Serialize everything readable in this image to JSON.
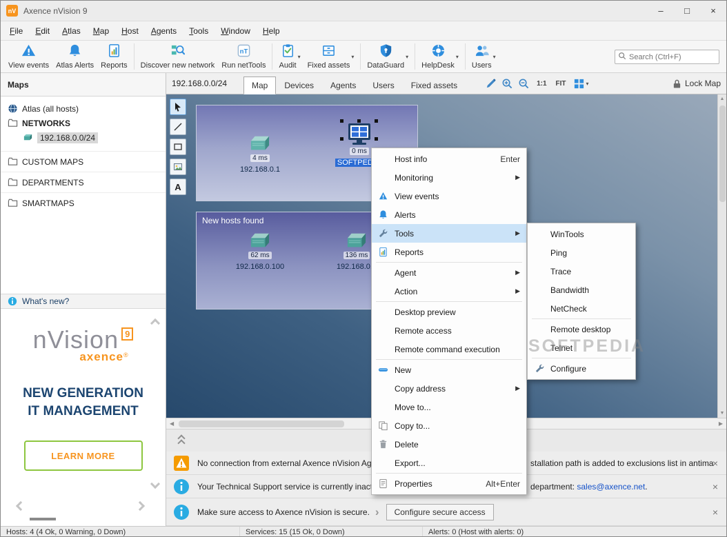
{
  "colors": {
    "accent_blue": "#2f8ede",
    "brand_orange": "#f7941e",
    "brand_green": "#8dc63f",
    "warning_orange": "#f59b00",
    "info_blue": "#29abe2",
    "menu_highlight": "#cbe3f8",
    "host_selection_blue": "#2a6bd4",
    "map_dark": "#27496c",
    "map_light": "#9aa9ba"
  },
  "window": {
    "icon_text": "nV",
    "title": "Axence nVision 9",
    "controls": {
      "minimize": "–",
      "maximize": "□",
      "close": "×"
    }
  },
  "menubar": {
    "items": [
      {
        "label": "File"
      },
      {
        "label": "Edit"
      },
      {
        "label": "Atlas"
      },
      {
        "label": "Map"
      },
      {
        "label": "Host"
      },
      {
        "label": "Agents"
      },
      {
        "label": "Tools"
      },
      {
        "label": "Window"
      },
      {
        "label": "Help"
      }
    ]
  },
  "toolbar": {
    "view_events": "View events",
    "atlas_alerts": "Atlas Alerts",
    "reports": "Reports",
    "discover": "Discover new network",
    "nettools": "Run netTools",
    "nettools_badge": "nT",
    "audit": "Audit",
    "fixed_assets": "Fixed assets",
    "dataguard": "DataGuard",
    "helpdesk": "HelpDesk",
    "users": "Users",
    "search_placeholder": "Search (Ctrl+F)"
  },
  "sidebar": {
    "header": "Maps",
    "tree": {
      "atlas": "Atlas (all hosts)",
      "networks": "NETWORKS",
      "network_child": "192.168.0.0/24",
      "custom_maps": "CUSTOM MAPS",
      "departments": "DEPARTMENTS",
      "smartmaps": "SMARTMAPS"
    },
    "whats_new": "What's new?",
    "ad": {
      "logo_text": "nVision",
      "logo_badge": "9",
      "brand": "axence",
      "reg": "®",
      "headline1": "NEW GENERATION",
      "headline2": "IT MANAGEMENT",
      "cta": "LEARN MORE"
    }
  },
  "map_panel": {
    "network_label": "192.168.0.0/24",
    "tabs": [
      {
        "label": "Map"
      },
      {
        "label": "Devices"
      },
      {
        "label": "Agents"
      },
      {
        "label": "Users"
      },
      {
        "label": "Fixed assets"
      }
    ],
    "zoom_actual": "1:1",
    "zoom_fit": "FIT",
    "lock_label": "Lock Map",
    "text_tool_glyph": "A",
    "boxes": [
      {
        "title": "",
        "hosts": [
          {
            "ping": "4 ms",
            "name": "192.168.0.1"
          },
          {
            "ping": "0 ms",
            "name": "SOFTPEDI..."
          }
        ]
      },
      {
        "title": "New hosts found",
        "hosts": [
          {
            "ping": "62 ms",
            "name": "192.168.0.100"
          },
          {
            "ping": "136 ms",
            "name": "192.168.0..."
          }
        ]
      }
    ]
  },
  "context_menu": {
    "items": [
      {
        "label": "Host info",
        "shortcut": "Enter"
      },
      {
        "label": "Monitoring"
      },
      {
        "label": "View events"
      },
      {
        "label": "Alerts"
      },
      {
        "label": "Tools"
      },
      {
        "label": "Reports"
      },
      {
        "label": "Agent"
      },
      {
        "label": "Action"
      },
      {
        "label": "Desktop preview"
      },
      {
        "label": "Remote access"
      },
      {
        "label": "Remote command execution"
      },
      {
        "label": "New"
      },
      {
        "label": "Copy address"
      },
      {
        "label": "Move to..."
      },
      {
        "label": "Copy to..."
      },
      {
        "label": "Delete"
      },
      {
        "label": "Export..."
      },
      {
        "label": "Properties",
        "shortcut": "Alt+Enter"
      }
    ]
  },
  "submenu": {
    "items": [
      {
        "label": "WinTools"
      },
      {
        "label": "Ping"
      },
      {
        "label": "Trace"
      },
      {
        "label": "Bandwidth"
      },
      {
        "label": "NetCheck"
      },
      {
        "label": "Remote desktop"
      },
      {
        "label": "Telnet"
      },
      {
        "label": "Configure"
      }
    ]
  },
  "notifications": [
    {
      "type": "warning",
      "text_left": "No connection from external Axence nVision Agen",
      "text_right": "stallation path is added to exclusions list in antima"
    },
    {
      "type": "info",
      "text_left": "Your Technical Support service is currently inactiv",
      "right_prefix": "department: ",
      "link": "sales@axence.net",
      "right_suffix": "."
    },
    {
      "type": "info",
      "text_left": "Make sure access to Axence nVision is secure.",
      "button": "Configure secure access"
    }
  ],
  "statusbar": {
    "hosts": "Hosts: 4 (4 Ok, 0 Warning, 0 Down)",
    "services": "Services: 15 (15 Ok, 0 Down)",
    "alerts": "Alerts: 0 (Host with alerts: 0)"
  },
  "watermark": "SOFTPEDIA"
}
